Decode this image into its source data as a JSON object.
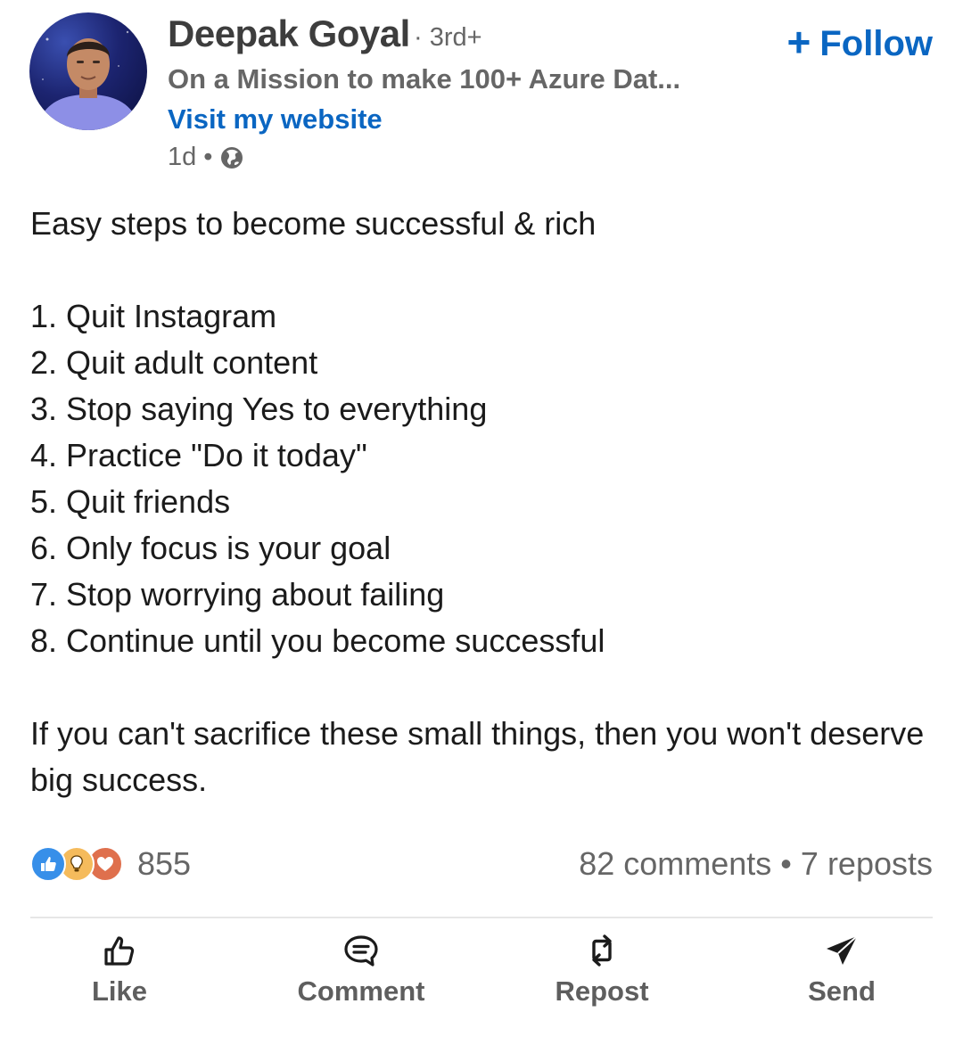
{
  "author": {
    "name": "Deepak Goyal",
    "degree": "· 3rd+",
    "headline": "On a Mission to make 100+ Azure Dat...",
    "website_link": "Visit my website",
    "time": "1d",
    "meta_sep": "•",
    "visibility_icon": "globe-icon"
  },
  "follow": {
    "plus": "+",
    "label": "Follow"
  },
  "post": {
    "intro": "Easy steps to become successful & rich",
    "steps": [
      "1.  Quit Instagram",
      "2. Quit adult content",
      "3. Stop saying Yes to everything",
      "4. Practice \"Do it today\"",
      "5. Quit friends",
      "6. Only focus is your goal",
      "7. Stop worrying about failing",
      "8. Continue until you become successful"
    ],
    "closing": "If you can't sacrifice these small things, then you won't deserve big success."
  },
  "social": {
    "reaction_icons": [
      "like-reaction-icon",
      "insightful-reaction-icon",
      "love-reaction-icon"
    ],
    "reaction_count": "855",
    "comments": "82 comments",
    "sep": "•",
    "reposts": "7 reposts"
  },
  "actions": {
    "like": "Like",
    "comment": "Comment",
    "repost": "Repost",
    "send": "Send"
  },
  "colors": {
    "accent": "#0a66c2",
    "muted": "#666666",
    "text": "#1b1b1b",
    "like_reaction": "#378fe9",
    "insightful_reaction": "#f5bb5c",
    "love_reaction": "#df704d"
  }
}
